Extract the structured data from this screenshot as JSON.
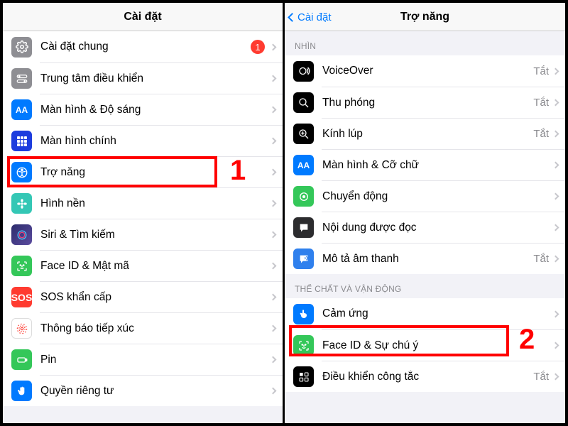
{
  "left": {
    "title": "Cài đặt",
    "rows": [
      {
        "id": "general",
        "label": "Cài đặt chung",
        "badge": "1"
      },
      {
        "id": "control-center",
        "label": "Trung tâm điều khiển"
      },
      {
        "id": "display",
        "label": "Màn hình & Độ sáng"
      },
      {
        "id": "home",
        "label": "Màn hình chính"
      },
      {
        "id": "accessibility",
        "label": "Trợ năng"
      },
      {
        "id": "wallpaper",
        "label": "Hình nền"
      },
      {
        "id": "siri",
        "label": "Siri & Tìm kiếm"
      },
      {
        "id": "faceid",
        "label": "Face ID & Mật mã"
      },
      {
        "id": "sos",
        "label": "SOS khẩn cấp",
        "sos": "SOS"
      },
      {
        "id": "exposure",
        "label": "Thông báo tiếp xúc"
      },
      {
        "id": "battery",
        "label": "Pin"
      },
      {
        "id": "privacy",
        "label": "Quyền riêng tư"
      }
    ]
  },
  "right": {
    "back": "Cài đặt",
    "title": "Trợ năng",
    "section1": "NHÌN",
    "section2": "THỂ CHẤT VÀ VẬN ĐỘNG",
    "off": "Tắt",
    "rows1": [
      {
        "id": "voiceover",
        "label": "VoiceOver",
        "value": "Tắt"
      },
      {
        "id": "zoom",
        "label": "Thu phóng",
        "value": "Tắt"
      },
      {
        "id": "magnifier",
        "label": "Kính lúp",
        "value": "Tắt"
      },
      {
        "id": "textsize",
        "label": "Màn hình & Cỡ chữ"
      },
      {
        "id": "motion",
        "label": "Chuyển động"
      },
      {
        "id": "spoken",
        "label": "Nội dung được đọc"
      },
      {
        "id": "audiodesc",
        "label": "Mô tả âm thanh",
        "value": "Tắt"
      }
    ],
    "rows2": [
      {
        "id": "touch",
        "label": "Cảm ứng"
      },
      {
        "id": "faceatt",
        "label": "Face ID & Sự chú ý"
      },
      {
        "id": "switch",
        "label": "Điều khiển công tắc",
        "value": "Tắt"
      }
    ]
  },
  "annot": {
    "one": "1",
    "two": "2"
  }
}
